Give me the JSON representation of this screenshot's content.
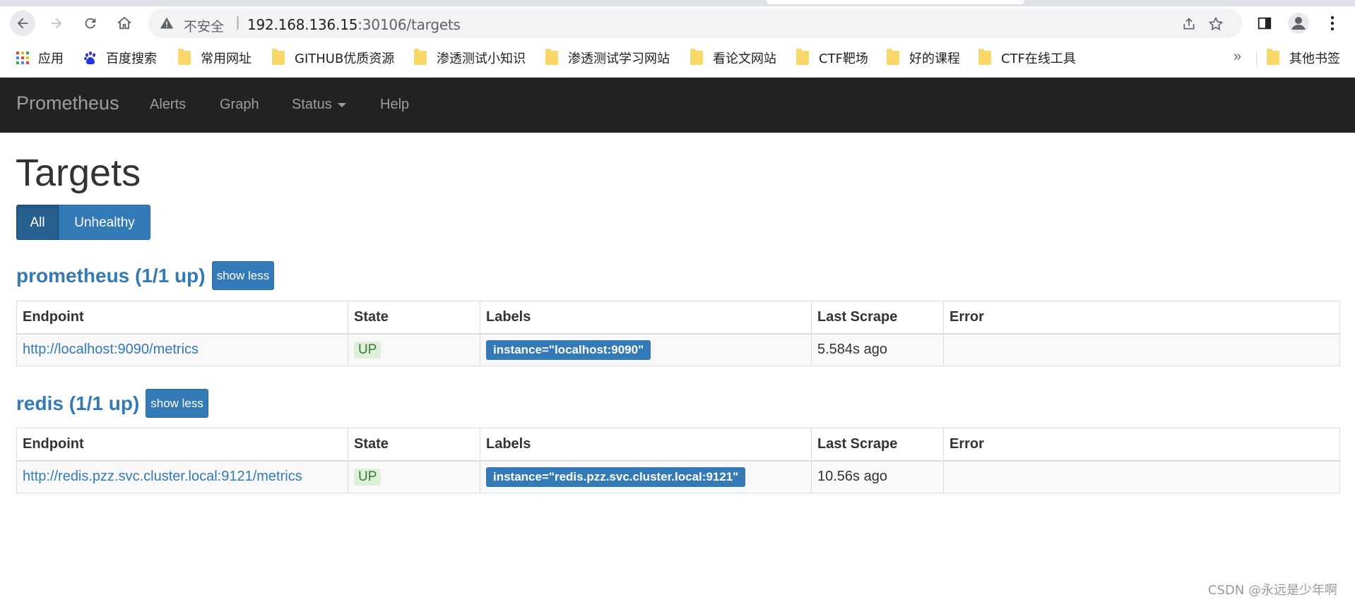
{
  "browser": {
    "insecure_label": "不安全",
    "url_host": "192.168.136.15",
    "url_rest": ":30106/targets",
    "bookmarks": [
      {
        "label": "应用",
        "icon": "apps-grid-icon"
      },
      {
        "label": "百度搜索",
        "icon": "baidu-paw-icon"
      },
      {
        "label": "常用网址",
        "icon": "folder-icon"
      },
      {
        "label": "GITHUB优质资源",
        "icon": "folder-icon"
      },
      {
        "label": "渗透测试小知识",
        "icon": "folder-icon"
      },
      {
        "label": "渗透测试学习网站",
        "icon": "folder-icon"
      },
      {
        "label": "看论文网站",
        "icon": "folder-icon"
      },
      {
        "label": "CTF靶场",
        "icon": "folder-icon"
      },
      {
        "label": "好的课程",
        "icon": "folder-icon"
      },
      {
        "label": "CTF在线工具",
        "icon": "folder-icon"
      }
    ],
    "overflow_label": "»",
    "other_bookmarks": "其他书签"
  },
  "navbar": {
    "brand": "Prometheus",
    "links": [
      "Alerts",
      "Graph",
      "Status",
      "Help"
    ]
  },
  "page": {
    "title": "Targets",
    "filters": {
      "all": "All",
      "unhealthy": "Unhealthy",
      "active": "All"
    }
  },
  "table_headers": [
    "Endpoint",
    "State",
    "Labels",
    "Last Scrape",
    "Error"
  ],
  "jobs": [
    {
      "title": "prometheus (1/1 up)",
      "toggle": "show less",
      "rows": [
        {
          "endpoint": "http://localhost:9090/metrics",
          "state": "UP",
          "labels": "instance=\"localhost:9090\"",
          "last_scrape": "5.584s ago",
          "error": ""
        }
      ]
    },
    {
      "title": "redis (1/1 up)",
      "toggle": "show less",
      "rows": [
        {
          "endpoint": "http://redis.pzz.svc.cluster.local:9121/metrics",
          "state": "UP",
          "labels": "instance=\"redis.pzz.svc.cluster.local:9121\"",
          "last_scrape": "10.56s ago",
          "error": ""
        }
      ]
    }
  ],
  "watermark": "CSDN @永远是少年啊",
  "colors": {
    "navbar_bg": "#222222",
    "primary": "#337ab7",
    "up_bg": "#dff0d8",
    "up_text": "#3c763d"
  }
}
